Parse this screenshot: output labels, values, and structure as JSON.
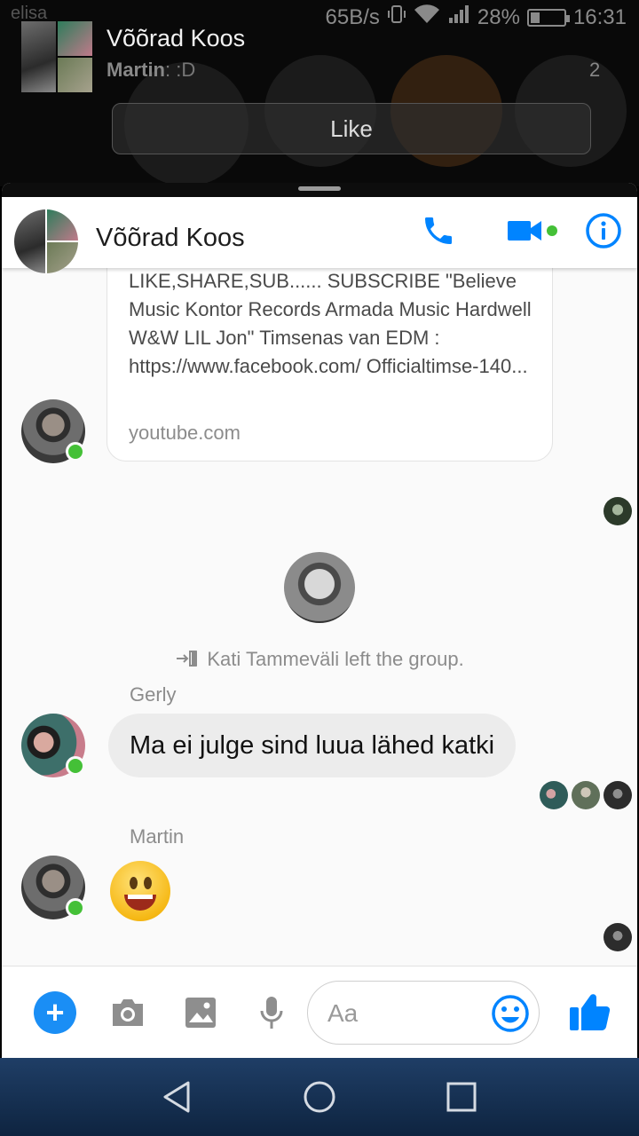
{
  "status_bar": {
    "carrier": "elisa",
    "net_speed": "65B/s",
    "battery": "28%",
    "battery_level": 0.28,
    "time": "16:31"
  },
  "notification": {
    "title": "Võõrad Koos",
    "sender": "Martin",
    "message": ": :D",
    "count": "2",
    "like_label": "Like"
  },
  "header": {
    "title": "Võõrad Koos",
    "accent": "#0084ff",
    "online_color": "#44c037"
  },
  "link_card": {
    "description": "LIKE,SHARE,SUB...... SUBSCRIBE \"Believe Music Kontor Records Armada Music Hardwell W&W LIL Jon\" Timsenas van EDM : https://www.facebook.com/ Officialtimse-140...",
    "domain": "youtube.com"
  },
  "system_message": {
    "text": "Kati Tammeväli left the group."
  },
  "messages": [
    {
      "sender": "Gerly",
      "text": "Ma ei julge sind luua lähed katki"
    },
    {
      "sender": "Martin",
      "text": ""
    }
  ],
  "composer": {
    "placeholder": "Aa"
  }
}
